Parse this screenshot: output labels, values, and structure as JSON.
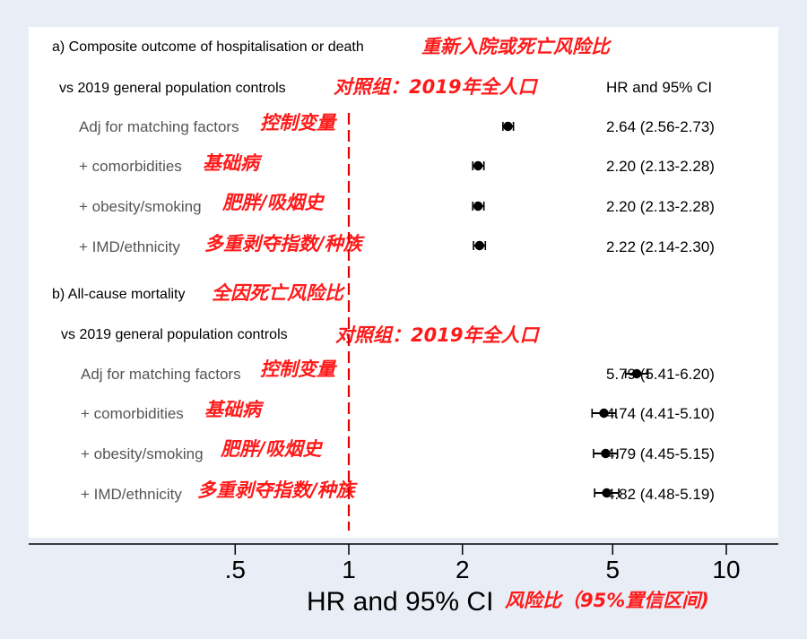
{
  "chart_data": {
    "type": "scatter",
    "subtype": "forest-plot",
    "xscale": "log",
    "xticks": [
      ".5",
      "1",
      "2",
      "5",
      "10"
    ],
    "xtick_values": [
      0.5,
      1,
      2,
      5,
      10
    ],
    "reference_line": 1,
    "xlabel": "HR and 95% CI",
    "xlabel_annotation": "风险比（95%置信区间)",
    "ci_column_header": "HR and 95% CI",
    "panels": [
      {
        "title": "a) Composite outcome of hospitalisation or death",
        "title_annotation": "重新入院或死亡风险比",
        "comparison": "vs 2019 general population controls",
        "comparison_annotation": "对照组：2019年全人口",
        "rows": [
          {
            "label": "Adj for matching factors",
            "annotation": "控制变量",
            "hr": 2.64,
            "lo": 2.56,
            "hi": 2.73,
            "text": "2.64 (2.56-2.73)"
          },
          {
            "label": "+ comorbidities",
            "annotation": "基础病",
            "hr": 2.2,
            "lo": 2.13,
            "hi": 2.28,
            "text": "2.20 (2.13-2.28)"
          },
          {
            "label": "+ obesity/smoking",
            "annotation": "肥胖/吸烟史",
            "hr": 2.2,
            "lo": 2.13,
            "hi": 2.28,
            "text": "2.20 (2.13-2.28)"
          },
          {
            "label": "+ IMD/ethnicity",
            "annotation": "多重剥夺指数/种族",
            "hr": 2.22,
            "lo": 2.14,
            "hi": 2.3,
            "text": "2.22 (2.14-2.30)"
          }
        ]
      },
      {
        "title": "b) All-cause mortality",
        "title_annotation": "全因死亡风险比",
        "comparison": "vs 2019 general population controls",
        "comparison_annotation": "对照组：2019年全人口",
        "rows": [
          {
            "label": "Adj for matching factors",
            "annotation": "控制变量",
            "hr": 5.79,
            "lo": 5.41,
            "hi": 6.2,
            "text": "5.79 (5.41-6.20)"
          },
          {
            "label": "+ comorbidities",
            "annotation": "基础病",
            "hr": 4.74,
            "lo": 4.41,
            "hi": 5.1,
            "text": "4.74 (4.41-5.10)"
          },
          {
            "label": "+ obesity/smoking",
            "annotation": "肥胖/吸烟史",
            "hr": 4.79,
            "lo": 4.45,
            "hi": 5.15,
            "text": "4.79 (4.45-5.15)"
          },
          {
            "label": "+ IMD/ethnicity",
            "annotation": "多重剥夺指数/种族",
            "hr": 4.82,
            "lo": 4.48,
            "hi": 5.19,
            "text": "4.82 (4.48-5.19)"
          }
        ]
      }
    ]
  },
  "colors": {
    "background": "#e9edf6",
    "plot_background": "#ffffff",
    "annotation": "#ff1a1a",
    "reference_line": "#e00000",
    "marker": "#000000",
    "row_label": "#555555"
  }
}
